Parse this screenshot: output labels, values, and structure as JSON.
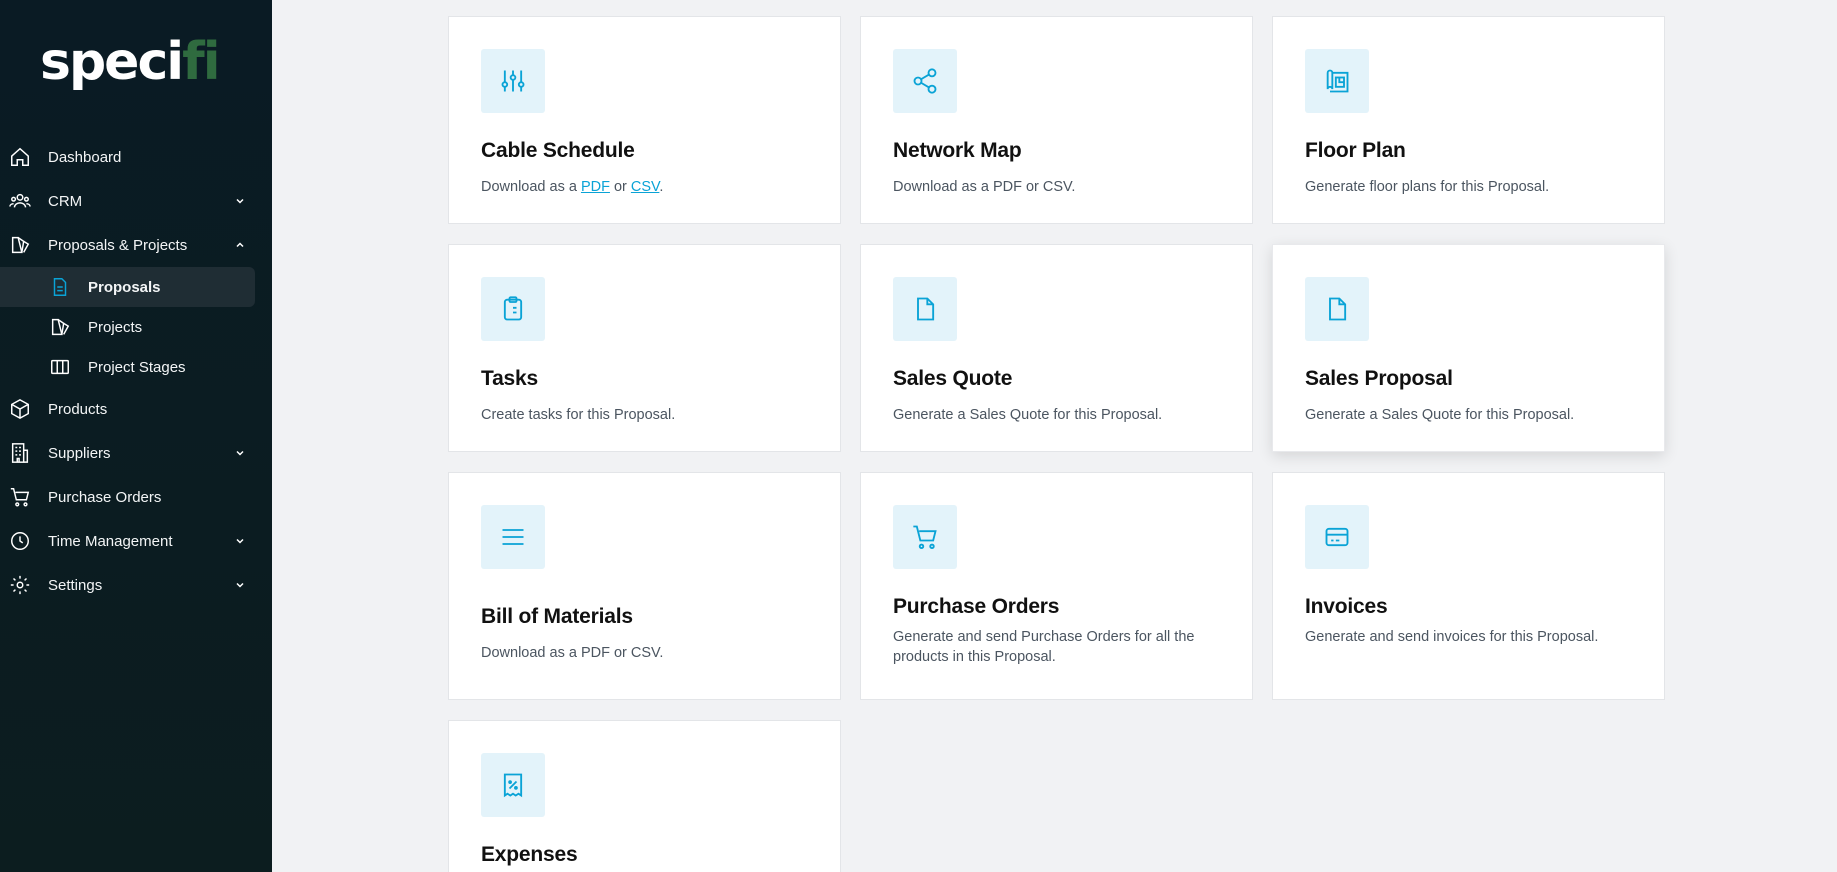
{
  "brand": {
    "logo_main": "speci",
    "logo_tail": "fi"
  },
  "colors": {
    "accent": "#0aa3d6",
    "tile_bg": "#e3f3fa",
    "sidebar_bg": "#0a1b24"
  },
  "sidebar": {
    "items": [
      {
        "label": "Dashboard",
        "icon": "home-icon"
      },
      {
        "label": "CRM",
        "icon": "users-icon"
      },
      {
        "label": "Proposals & Projects",
        "icon": "projects-icon"
      },
      {
        "label": "Proposals",
        "icon": "document-icon",
        "active": true
      },
      {
        "label": "Projects",
        "icon": "projects-icon"
      },
      {
        "label": "Project Stages",
        "icon": "columns-icon"
      },
      {
        "label": "Products",
        "icon": "box-icon"
      },
      {
        "label": "Suppliers",
        "icon": "building-icon"
      },
      {
        "label": "Purchase Orders",
        "icon": "cart-icon"
      },
      {
        "label": "Time Management",
        "icon": "clock-icon"
      },
      {
        "label": "Settings",
        "icon": "gear-icon"
      }
    ]
  },
  "cards": {
    "cable_schedule": {
      "title": "Cable Schedule",
      "desc_prefix": "Download as a ",
      "link_pdf": "PDF",
      "desc_mid": " or ",
      "link_csv": "CSV",
      "desc_suffix": "."
    },
    "network_map": {
      "title": "Network Map",
      "desc": "Download as a PDF or CSV."
    },
    "floor_plan": {
      "title": "Floor Plan",
      "desc": "Generate floor plans for this Proposal."
    },
    "tasks": {
      "title": "Tasks",
      "desc": "Create tasks for this Proposal."
    },
    "sales_quote": {
      "title": "Sales Quote",
      "desc": "Generate a Sales Quote for this Proposal."
    },
    "sales_proposal": {
      "title": "Sales Proposal",
      "desc": "Generate a Sales Quote for this Proposal."
    },
    "bill_of_materials": {
      "title": "Bill of Materials",
      "desc": "Download as a PDF or CSV."
    },
    "purchase_orders": {
      "title": "Purchase Orders",
      "desc": "Generate and send Purchase Orders for all the products in this Proposal."
    },
    "invoices": {
      "title": "Invoices",
      "desc": "Generate and send invoices for this Proposal."
    },
    "expenses": {
      "title": "Expenses"
    }
  }
}
